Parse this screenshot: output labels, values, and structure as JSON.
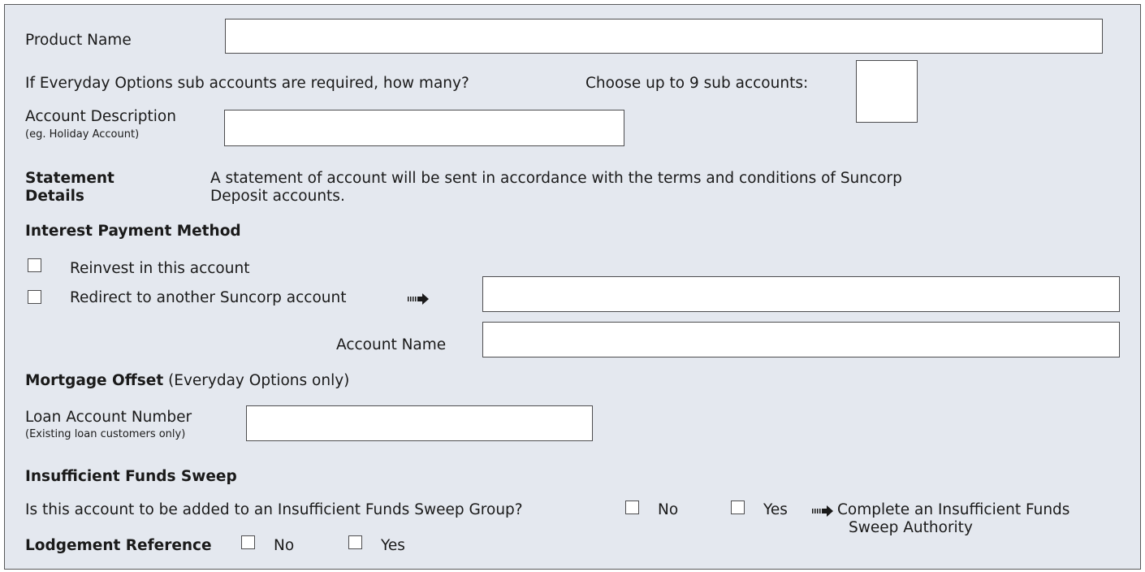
{
  "product": {
    "label": "Product Name",
    "value": ""
  },
  "sub_accounts": {
    "question": "If Everyday Options sub accounts are required, how many?",
    "choose_label": "Choose up to 9 sub accounts:",
    "value": ""
  },
  "account_description": {
    "label": "Account Description",
    "hint": "(eg. Holiday Account)",
    "value": ""
  },
  "statement": {
    "heading_line1": "Statement",
    "heading_line2": "Details",
    "text_line1": "A statement of account will be sent in accordance with the terms and conditions of Suncorp",
    "text_line2": "Deposit accounts."
  },
  "interest": {
    "heading": "Interest Payment Method",
    "reinvest_label": "Reinvest in this account",
    "redirect_label": "Redirect to another Suncorp account",
    "redirect_account_value": "",
    "account_name_label": "Account Name",
    "account_name_value": ""
  },
  "mortgage": {
    "heading": "Mortgage Offset",
    "heading_note": "(Everyday Options only)",
    "loan_label": "Loan Account Number",
    "loan_hint": "(Existing loan customers only)",
    "loan_value": ""
  },
  "sweep": {
    "heading": "Insufficient Funds Sweep",
    "question": "Is this account to be added to an Insufficient Funds Sweep Group?",
    "no_label": "No",
    "yes_label": "Yes",
    "instruction_line1": "Complete an Insufficient Funds",
    "instruction_line2": "Sweep Authority"
  },
  "lodgement": {
    "heading": "Lodgement Reference",
    "no_label": "No",
    "yes_label": "Yes"
  },
  "colors": {
    "panel_background": "#e4e8ef",
    "border": "#4d4d4f",
    "field_background": "#ffffff"
  }
}
